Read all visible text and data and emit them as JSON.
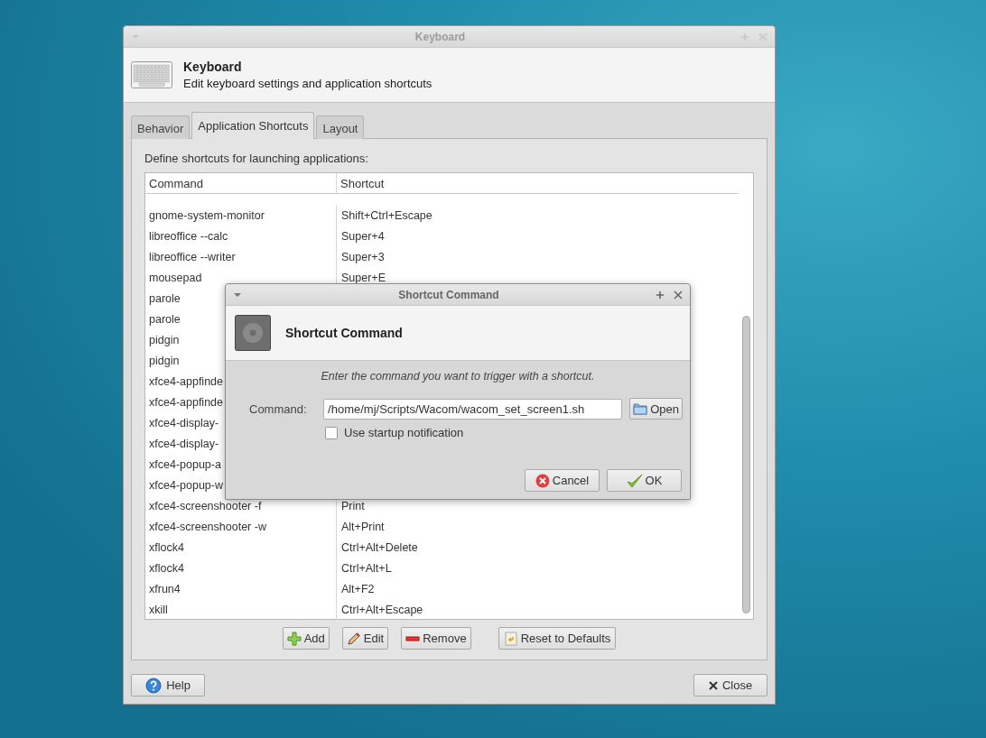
{
  "window": {
    "title": "Keyboard",
    "heading": "Keyboard",
    "subheading": "Edit keyboard settings and application shortcuts"
  },
  "tabs": [
    {
      "label": "Behavior",
      "selected": false
    },
    {
      "label": "Application Shortcuts",
      "selected": true
    },
    {
      "label": "Layout",
      "selected": false
    }
  ],
  "panel": {
    "description": "Define shortcuts for launching applications:"
  },
  "table": {
    "columns": [
      "Command",
      "Shortcut"
    ],
    "rows": [
      {
        "command": "gnome-system-monitor",
        "shortcut": "Shift+Ctrl+Escape"
      },
      {
        "command": "libreoffice --calc",
        "shortcut": "Super+4"
      },
      {
        "command": "libreoffice --writer",
        "shortcut": "Super+3"
      },
      {
        "command": "mousepad",
        "shortcut": "Super+E"
      },
      {
        "command": "parole"
      },
      {
        "command": "parole"
      },
      {
        "command": "pidgin"
      },
      {
        "command": "pidgin"
      },
      {
        "command": "xfce4-appfinde"
      },
      {
        "command": "xfce4-appfinde"
      },
      {
        "command": "xfce4-display-"
      },
      {
        "command": "xfce4-display-"
      },
      {
        "command": "xfce4-popup-a"
      },
      {
        "command": "xfce4-popup-w"
      },
      {
        "command": "xfce4-screenshooter -f",
        "shortcut": "Print"
      },
      {
        "command": "xfce4-screenshooter -w",
        "shortcut": "Alt+Print"
      },
      {
        "command": "xflock4",
        "shortcut": "Ctrl+Alt+Delete"
      },
      {
        "command": "xflock4",
        "shortcut": "Ctrl+Alt+L"
      },
      {
        "command": "xfrun4",
        "shortcut": "Alt+F2"
      },
      {
        "command": "xkill",
        "shortcut": "Ctrl+Alt+Escape"
      }
    ]
  },
  "table_buttons": [
    {
      "label": "Add",
      "kind": "add"
    },
    {
      "label": "Edit",
      "kind": "edit"
    },
    {
      "label": "Remove",
      "kind": "remove"
    },
    {
      "label": "Reset to Defaults",
      "kind": "reset"
    }
  ],
  "footer_buttons": [
    {
      "label": "Help",
      "kind": "help"
    },
    {
      "label": "Close",
      "kind": "close"
    }
  ],
  "dialog": {
    "title": "Shortcut Command",
    "heading": "Shortcut Command",
    "instruction": "Enter the command you want to trigger with a shortcut.",
    "field_label": "Command:",
    "value": "/home/mj/Scripts/Wacom/wacom_set_screen1.sh",
    "open_button": "Open",
    "checkbox": {
      "label": "Use startup notification",
      "checked": false
    },
    "buttons": [
      {
        "label": "Cancel",
        "kind": "cancel"
      },
      {
        "label": "OK",
        "kind": "ok"
      }
    ]
  }
}
